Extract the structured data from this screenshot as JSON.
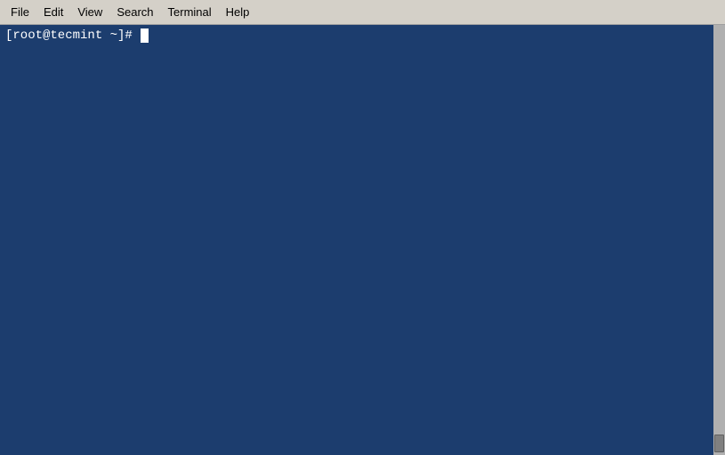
{
  "menubar": {
    "items": [
      {
        "id": "file",
        "label": "File"
      },
      {
        "id": "edit",
        "label": "Edit"
      },
      {
        "id": "view",
        "label": "View"
      },
      {
        "id": "search",
        "label": "Search"
      },
      {
        "id": "terminal",
        "label": "Terminal"
      },
      {
        "id": "help",
        "label": "Help"
      }
    ]
  },
  "terminal": {
    "prompt": "[root@tecmint ~]# "
  }
}
